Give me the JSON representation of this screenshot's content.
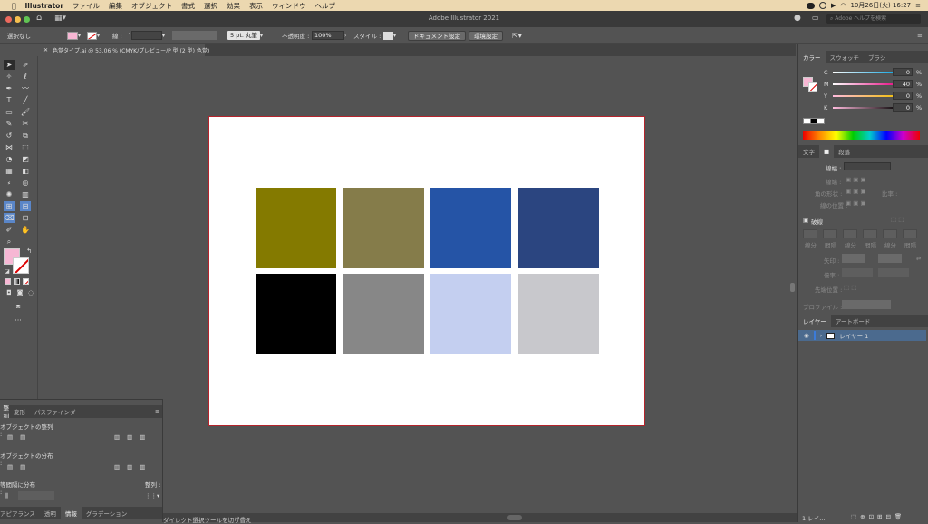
{
  "menubar": {
    "apple": "",
    "app": "Illustrator",
    "items": [
      "ファイル",
      "編集",
      "オブジェクト",
      "書式",
      "選択",
      "効果",
      "表示",
      "ウィンドウ",
      "ヘルプ"
    ],
    "datetime": "10月26日(火) 16:27"
  },
  "titlebar": {
    "title": "Adobe Illustrator 2021",
    "search_placeholder": "Adobe ヘルプを検索"
  },
  "control": {
    "selection": "選択なし",
    "stroke_label": "線 :",
    "brush": "5 pt. 丸筆",
    "opacity_label": "不透明度 :",
    "opacity": "100%",
    "style_label": "スタイル :",
    "doc_setup": "ドキュメント設定",
    "prefs": "環境設定"
  },
  "document": {
    "tab_label": "色覚タイプ.ai @ 53.06 % (CMYK/プレビュー/P 型 (2 型) 色覚)"
  },
  "swatches": [
    "#847a00",
    "#857c4a",
    "#2554a6",
    "#2b4580",
    "#000000",
    "#878787",
    "#c4cff0",
    "#c8c8cc"
  ],
  "color_panel": {
    "tabs": [
      "カラー",
      "スウォッチ",
      "ブラシ"
    ],
    "channels": [
      {
        "name": "C",
        "value": "0",
        "unit": "%"
      },
      {
        "name": "M",
        "value": "40",
        "unit": "%"
      },
      {
        "name": "Y",
        "value": "0",
        "unit": "%"
      },
      {
        "name": "K",
        "value": "0",
        "unit": "%"
      }
    ]
  },
  "char_panel": {
    "tabs": [
      "文字",
      "段落"
    ],
    "rows": [
      "線幅 :",
      "線端 :",
      "角の形状 :",
      "線の位置 :"
    ],
    "miter_label": "比率 :"
  },
  "dash_panel": {
    "title": "破線",
    "labels": [
      "線分",
      "間隔",
      "線分",
      "間隔",
      "線分",
      "間隔"
    ],
    "arrow_label": "矢印 :",
    "scale_label": "倍率 :",
    "align_label": "先端位置 :",
    "profile_label": "プロファイル :"
  },
  "layers_panel": {
    "tabs": [
      "レイヤー",
      "アートボード"
    ],
    "layer_name": "レイヤー 1",
    "footer": "1 レイ..."
  },
  "align_panel": {
    "tabs": [
      "整列",
      "変形",
      "パスファインダー"
    ],
    "obj_align": "オブジェクトの整列 :",
    "obj_distribute": "オブジェクトの分布 :",
    "distribute_spacing": "等間隔に分布 :",
    "align_to": "整列 :",
    "bottom_tabs": [
      "アピアランス",
      "透明",
      "情報",
      "グラデーション"
    ]
  },
  "status": {
    "text": "ダイレクト選択ツールを切り替え"
  },
  "colors": {
    "accent": "#f7b7d4",
    "artboard_border": "#b5242c"
  }
}
